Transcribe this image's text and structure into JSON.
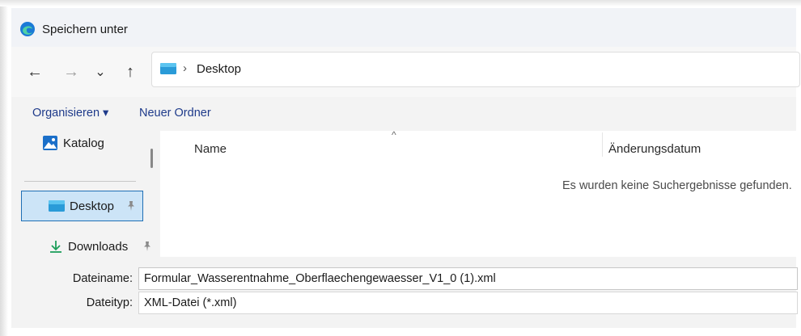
{
  "window": {
    "title": "Speichern unter",
    "app_icon": "edge-browser-icon"
  },
  "nav": {
    "back_icon": "←",
    "forward_icon": "→",
    "recent_icon": "⌄",
    "up_icon": "↑",
    "address": {
      "folder_icon": "desktop-folder-icon",
      "chevron": "›",
      "location": "Desktop"
    }
  },
  "toolbar": {
    "organize_label": "Organisieren ▾",
    "new_folder_label": "Neuer Ordner"
  },
  "sidebar": {
    "items": [
      {
        "label": "Katalog",
        "icon": "gallery-icon",
        "pinned": false,
        "selected": false
      },
      {
        "label": "Desktop",
        "icon": "desktop-icon",
        "pinned": true,
        "selected": true
      },
      {
        "label": "Downloads",
        "icon": "download-icon",
        "pinned": true,
        "selected": false
      }
    ]
  },
  "file_list": {
    "columns": [
      "Name",
      "Änderungsdatum"
    ],
    "sort_indicator": "^",
    "empty_message": "Es wurden keine Suchergebnisse gefunden."
  },
  "form": {
    "filename_label": "Dateiname:",
    "filename_value": "Formular_Wasserentnahme_Oberflaechengewaesser_V1_0 (1).xml",
    "filetype_label": "Dateityp:",
    "filetype_value": "XML-Datei (*.xml)"
  },
  "colors": {
    "selection_bg": "#cce4f7",
    "selection_border": "#1f6fb5",
    "link_text": "#1e3a8a"
  }
}
